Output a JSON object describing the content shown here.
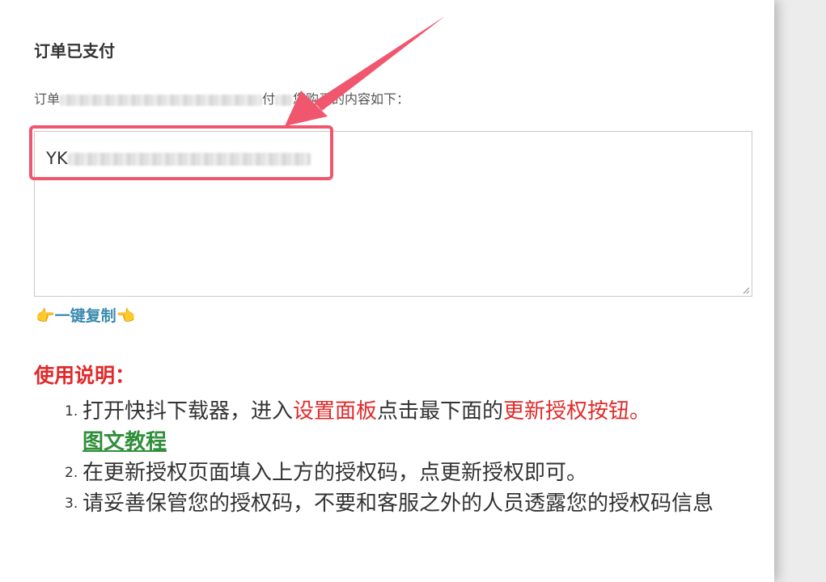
{
  "order": {
    "title": "订单已支付",
    "text_prefix": "订单",
    "text_mid": "付",
    "text_suffix": "您购买的内容如下："
  },
  "license": {
    "code_visible_prefix": "YK"
  },
  "copy": {
    "hand_left": "👉",
    "label": "一键复制",
    "hand_right": "👈"
  },
  "usage": {
    "title": "使用说明：",
    "steps": [
      {
        "num": "1.",
        "part1": "打开快抖下载器，进入",
        "part2_highlight": "设置面板",
        "part3": "点击最下面的",
        "part4_highlight": "更新授权按钮。",
        "link": "图文教程"
      },
      {
        "num": "2.",
        "text": "在更新授权页面填入上方的授权码，点更新授权即可。"
      },
      {
        "num": "3.",
        "text": "请妥善保管您的授权码，不要和客服之外的人员透露您的授权码信息"
      }
    ]
  },
  "colors": {
    "accent_red": "#e02a2a",
    "link_blue": "#3a8ab0",
    "link_green": "#2f8f3a",
    "annotation": "#f0566e"
  }
}
